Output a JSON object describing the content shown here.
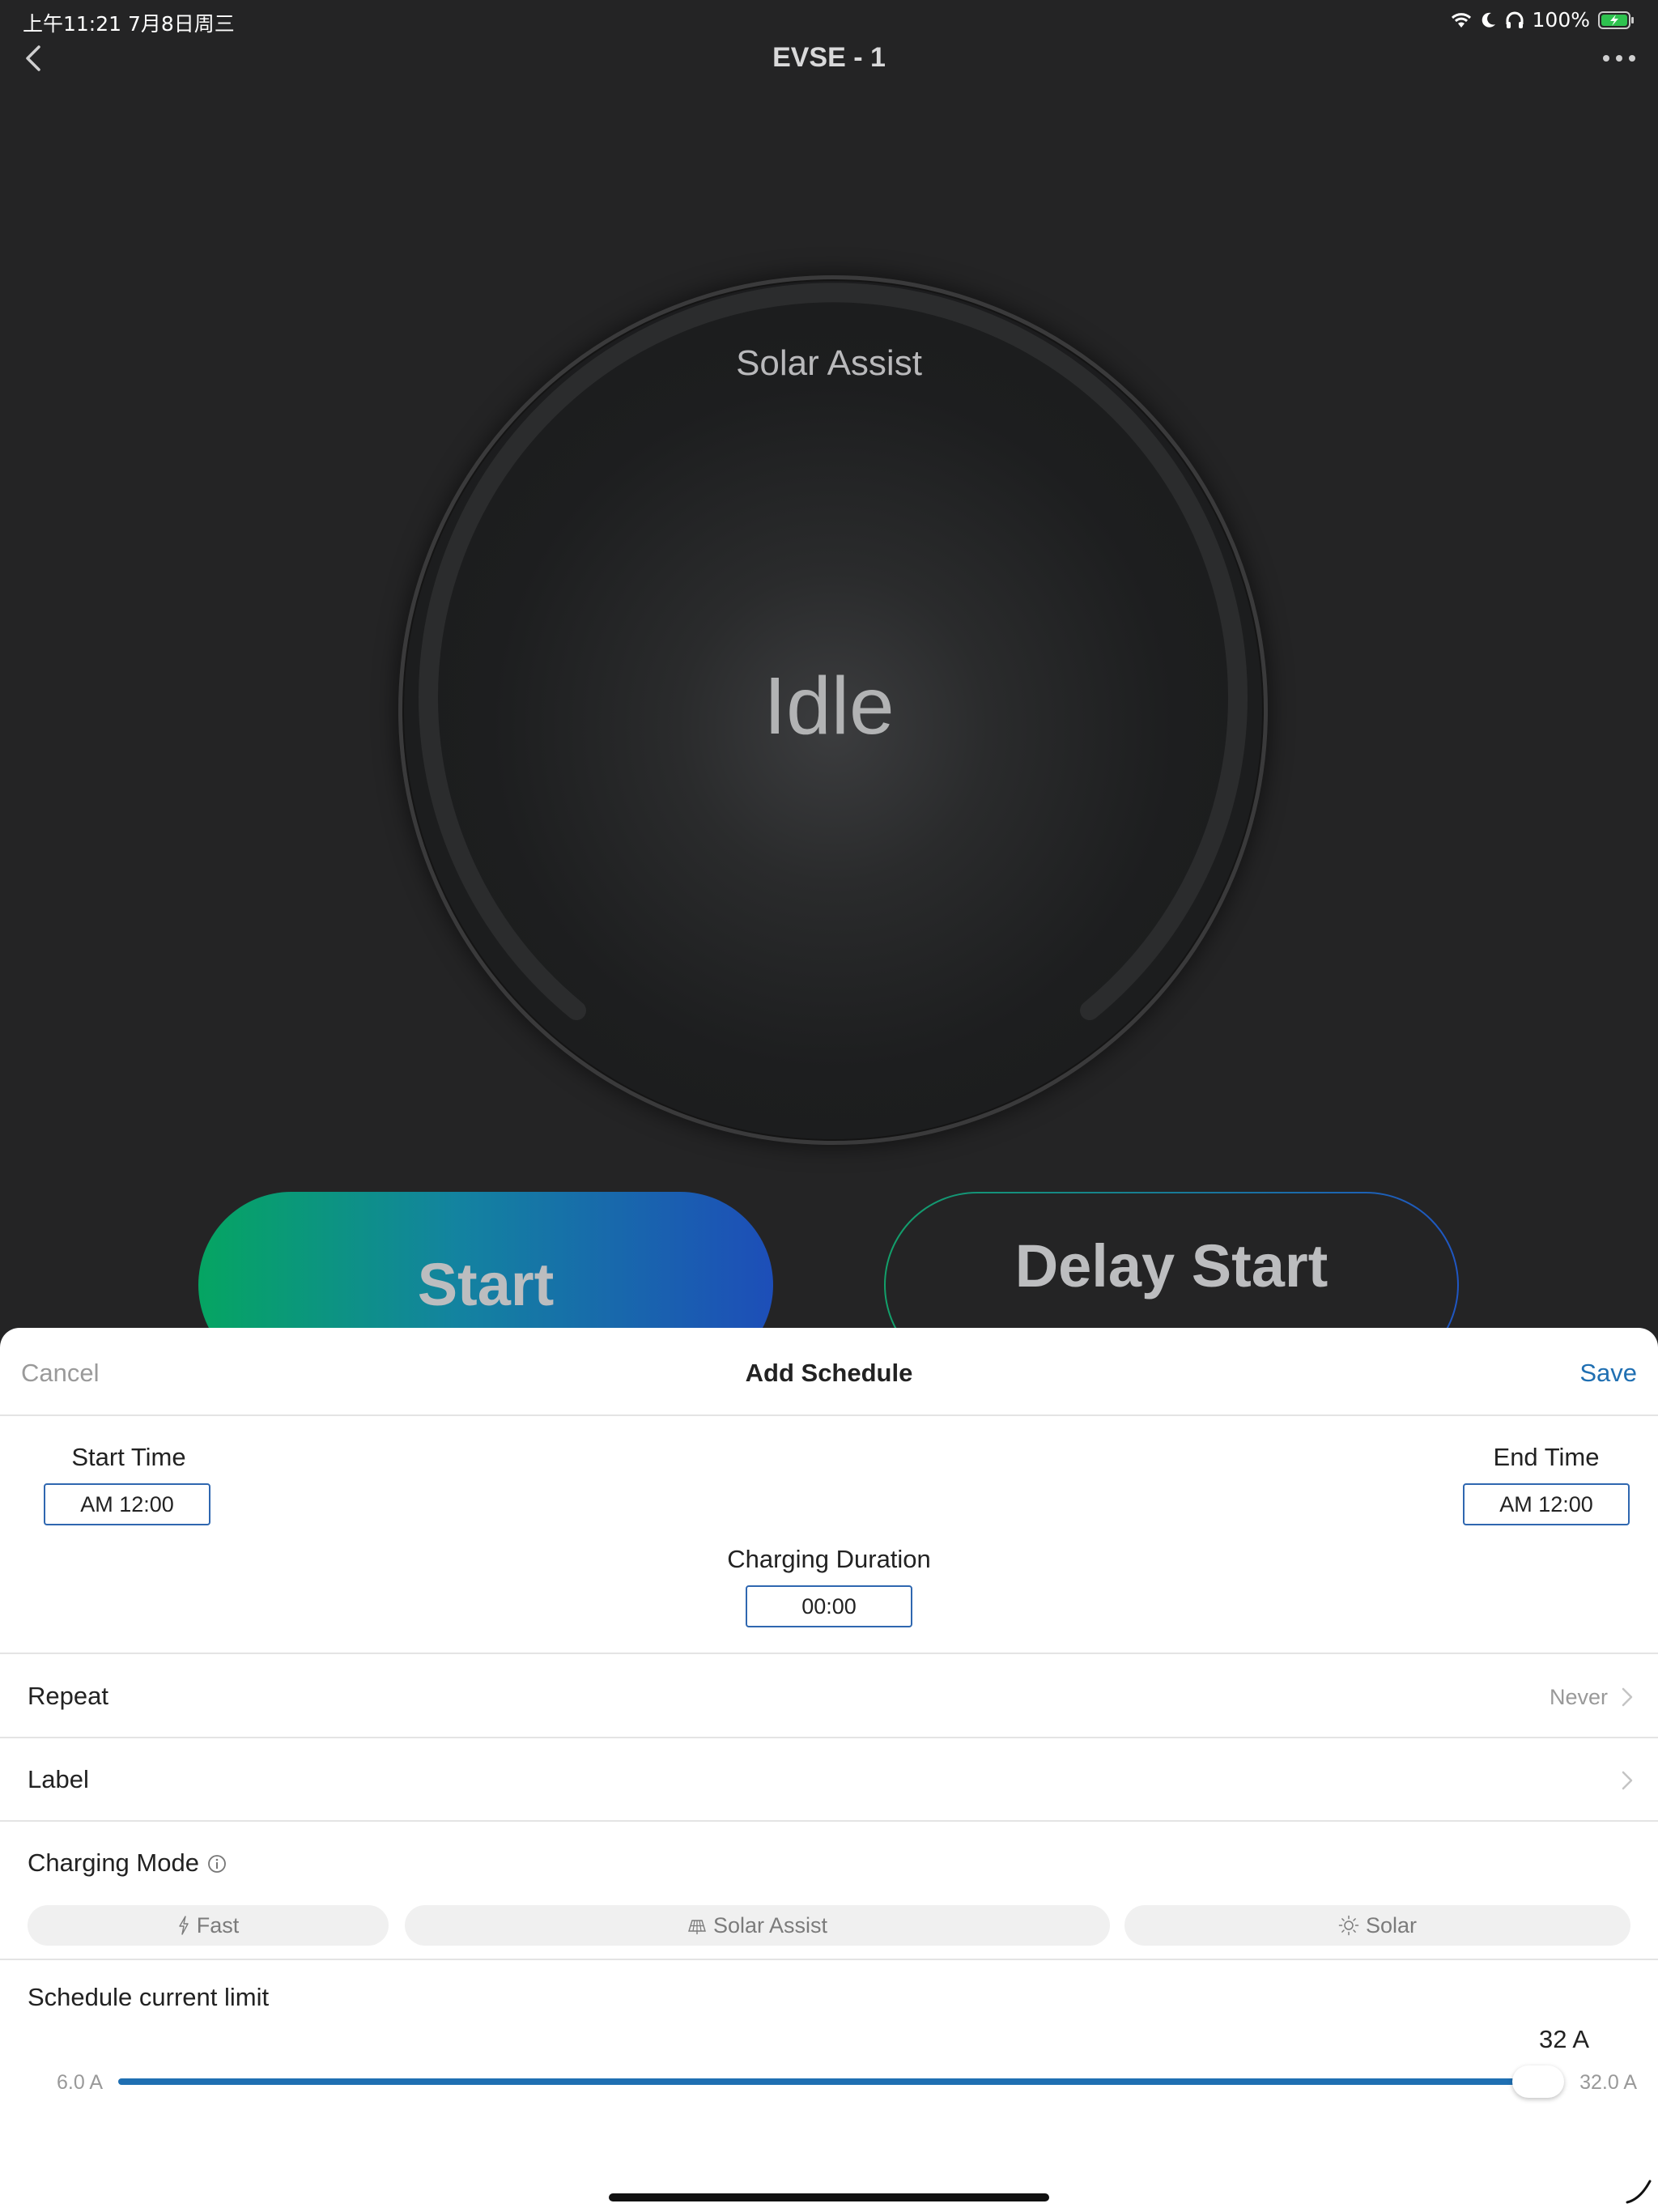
{
  "status_bar": {
    "time_date": "上午11:21  7月8日周三",
    "battery": "100%"
  },
  "nav": {
    "title": "EVSE - 1"
  },
  "dial": {
    "mode": "Solar Assist",
    "state": "Idle"
  },
  "actions": {
    "start_label": "Start",
    "delay_start_label": "Delay Start"
  },
  "sheet": {
    "cancel_label": "Cancel",
    "title": "Add Schedule",
    "save_label": "Save",
    "start_time_label": "Start Time",
    "start_time_value": "AM 12:00",
    "end_time_label": "End Time",
    "end_time_value": "AM 12:00",
    "duration_label": "Charging Duration",
    "duration_value": "00:00",
    "repeat_label": "Repeat",
    "repeat_value": "Never",
    "label_label": "Label",
    "charging_mode_label": "Charging Mode",
    "modes": [
      "Fast",
      "Solar Assist",
      "Solar"
    ],
    "current_limit_label": "Schedule current limit",
    "slider": {
      "min_label": "6.0 A",
      "max_label": "32.0 A",
      "value_label": "32 A",
      "value_fraction": 1.0
    }
  },
  "colors": {
    "accent": "#1f6fb2",
    "background": "#242425",
    "start_gradient": [
      "#05a562",
      "#1d4eb8"
    ]
  },
  "icons": [
    "back-chevron-icon",
    "more-dots-icon",
    "wifi-icon",
    "moon-icon",
    "headphones-icon",
    "battery-charging-icon",
    "info-icon",
    "bolt-icon",
    "solar-panel-icon",
    "sun-icon",
    "chevron-right-icon"
  ]
}
